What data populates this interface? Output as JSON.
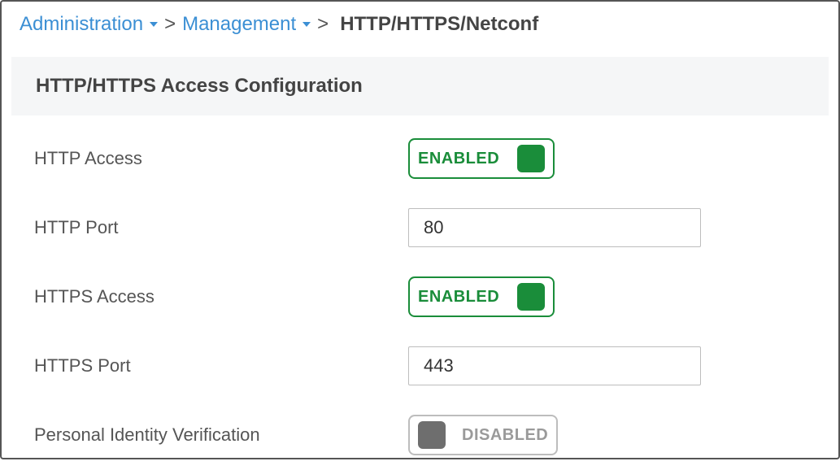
{
  "breadcrumb": {
    "items": [
      {
        "label": "Administration"
      },
      {
        "label": "Management"
      }
    ],
    "current": "HTTP/HTTPS/Netconf"
  },
  "section": {
    "title": "HTTP/HTTPS Access Configuration"
  },
  "form": {
    "http_access": {
      "label": "HTTP Access",
      "state": "ENABLED"
    },
    "http_port": {
      "label": "HTTP Port",
      "value": "80"
    },
    "https_access": {
      "label": "HTTPS Access",
      "state": "ENABLED"
    },
    "https_port": {
      "label": "HTTPS Port",
      "value": "443"
    },
    "piv": {
      "label": "Personal Identity Verification",
      "state": "DISABLED"
    }
  }
}
